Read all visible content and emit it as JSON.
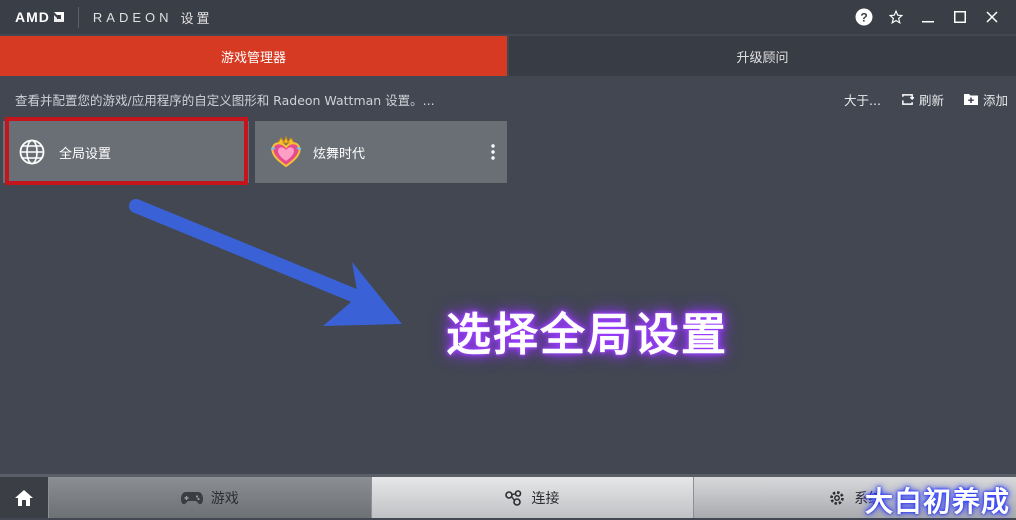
{
  "titlebar": {
    "brand_amd": "AMD",
    "brand_radeon": "RADEON",
    "brand_settings": "设置"
  },
  "tabs": [
    {
      "label": "游戏管理器",
      "active": true
    },
    {
      "label": "升级顾问",
      "active": false
    }
  ],
  "toolbar": {
    "description": "查看并配置您的游戏/应用程序的自定义图形和 Radeon Wattman 设置。...",
    "sort_label": "大于...",
    "refresh_label": "刷新",
    "add_label": "添加"
  },
  "cards": [
    {
      "label": "全局设置",
      "icon": "globe-icon"
    },
    {
      "label": "炫舞时代",
      "icon": "game-heart-crown-icon"
    }
  ],
  "annotation": {
    "callout": "选择全局设置"
  },
  "bottom_nav": {
    "games_label": "游戏",
    "connect_label": "连接",
    "system_label": "系统"
  },
  "watermark": "大白初养成",
  "colors": {
    "accent": "#d73a22",
    "background": "#424752",
    "highlight": "#c4141c",
    "arrow": "#3a62d6",
    "glow": "#9b3cff"
  }
}
